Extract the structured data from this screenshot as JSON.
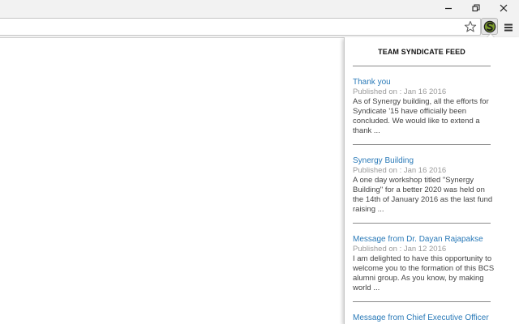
{
  "window": {
    "minimize_label": "Minimize",
    "restore_label": "Restore",
    "close_label": "Close"
  },
  "icons": {
    "minimize": "minimize-icon",
    "restore": "restore-icon",
    "close": "close-icon",
    "star": "star-icon",
    "extension": "syndicate-extension-icon",
    "menu": "menu-icon"
  },
  "colors": {
    "link": "#2a7ab8",
    "date": "#9a9a9a",
    "body": "#444444"
  },
  "popup": {
    "title": "TEAM SYNDICATE FEED",
    "items": [
      {
        "title": "Thank you",
        "date": "Published on : Jan 16 2016",
        "excerpt": "As of Synergy building, all the efforts for Syndicate '15 have officially been concluded. We would like to extend a thank ..."
      },
      {
        "title": "Synergy Building",
        "date": "Published on : Jan 16 2016",
        "excerpt": "A one day workshop titled \"Synergy Building\" for a better 2020 was held on the 14th of January 2016 as the last fund raising ..."
      },
      {
        "title": "Message from Dr. Dayan Rajapakse",
        "date": "Published on : Jan 12 2016",
        "excerpt": "I am delighted to have this opportunity to welcome you to the formation of this BCS alumni group. As you know, by making world ..."
      },
      {
        "title": "Message from Chief Executive Officer",
        "date": "",
        "excerpt": ""
      }
    ]
  }
}
